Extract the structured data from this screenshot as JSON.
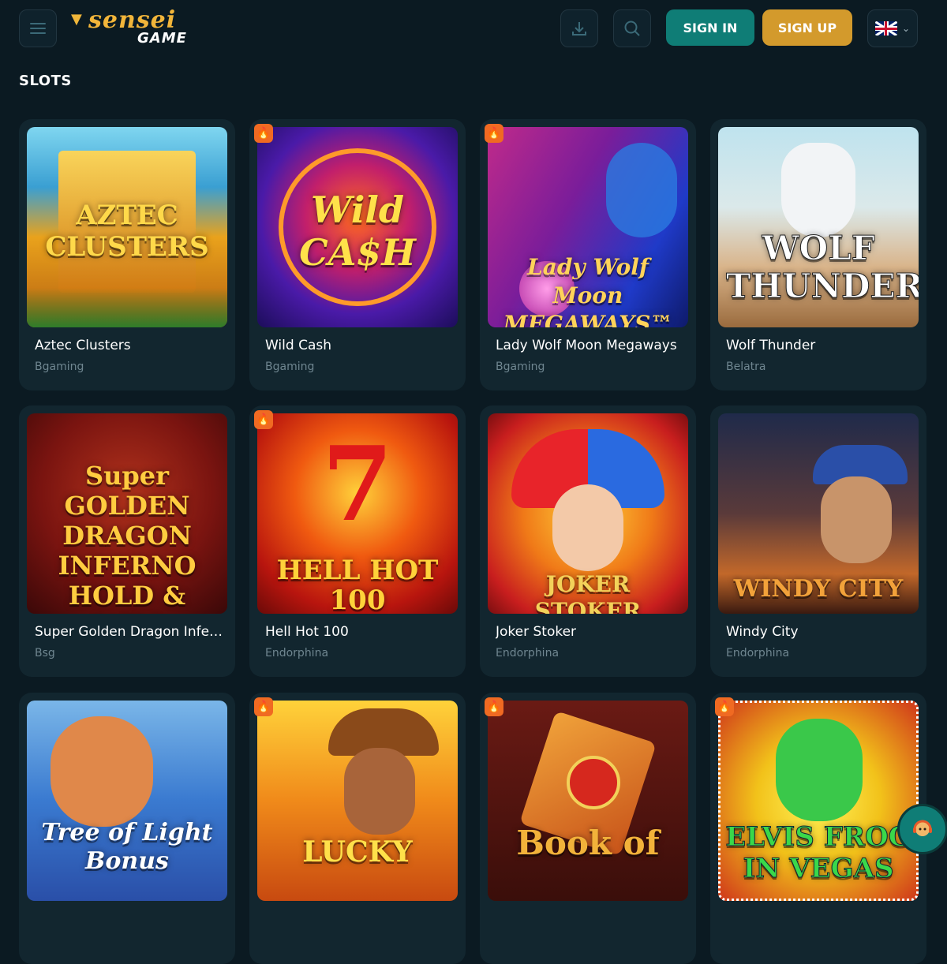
{
  "header": {
    "logo_word1": "sensei",
    "logo_word2": "GAME",
    "sign_in": "SIGN IN",
    "sign_up": "SIGN UP",
    "language_flag": "uk-flag-icon"
  },
  "section": {
    "title": "SLOTS"
  },
  "colors": {
    "background": "#0b1a22",
    "card": "#12262f",
    "sign_in_bg": "#0f7d76",
    "sign_up_bg": "#d39a2c",
    "hot_badge": "#f06a22",
    "provider_text": "#6f8690"
  },
  "games": [
    {
      "title": "Aztec Clusters",
      "provider": "Bgaming",
      "art_text": "AZTEC CLUSTERS",
      "hot": false
    },
    {
      "title": "Wild Cash",
      "provider": "Bgaming",
      "art_text": "Wild CA$H",
      "hot": true
    },
    {
      "title": "Lady Wolf Moon Megaways",
      "provider": "Bgaming",
      "art_text": "Lady Wolf Moon MEGAWAYS™",
      "hot": true
    },
    {
      "title": "Wolf Thunder",
      "provider": "Belatra",
      "art_text": "WOLF THUNDER",
      "hot": false
    },
    {
      "title": "Super Golden Dragon Infer...",
      "provider": "Bsg",
      "art_text": "Super GOLDEN DRAGON INFERNO HOLD & WIN",
      "hot": false
    },
    {
      "title": "Hell Hot 100",
      "provider": "Endorphina",
      "art_text": "HELL HOT 100",
      "hot": true
    },
    {
      "title": "Joker Stoker",
      "provider": "Endorphina",
      "art_text": "JOKER STOKER",
      "hot": false
    },
    {
      "title": "Windy City",
      "provider": "Endorphina",
      "art_text": "WINDY CITY",
      "hot": false
    },
    {
      "title": "",
      "provider": "",
      "art_text": "Tree of Light Bonus",
      "hot": false
    },
    {
      "title": "",
      "provider": "",
      "art_text": "LUCKY",
      "hot": true
    },
    {
      "title": "",
      "provider": "",
      "art_text": "Book of",
      "hot": true
    },
    {
      "title": "",
      "provider": "",
      "art_text": "ELVIS FROG IN VEGAS",
      "hot": true
    }
  ]
}
